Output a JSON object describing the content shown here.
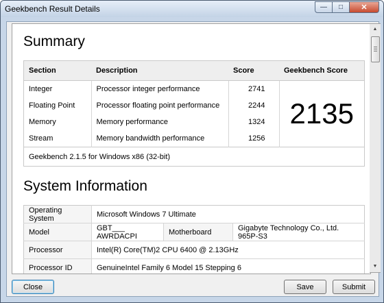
{
  "window": {
    "title": "Geekbench Result Details"
  },
  "window_buttons": {
    "minimize": "—",
    "maximize": "□",
    "close": "✕"
  },
  "summary": {
    "heading": "Summary",
    "columns": [
      "Section",
      "Description",
      "Score",
      "Geekbench Score"
    ],
    "rows": [
      {
        "section": "Integer",
        "description": "Processor integer performance",
        "score": "2741"
      },
      {
        "section": "Floating Point",
        "description": "Processor floating point performance",
        "score": "2244"
      },
      {
        "section": "Memory",
        "description": "Memory performance",
        "score": "1324"
      },
      {
        "section": "Stream",
        "description": "Memory bandwidth performance",
        "score": "1256"
      }
    ],
    "geekbench_score": "2135",
    "version_note": "Geekbench 2.1.5 for Windows x86 (32-bit)"
  },
  "system_information": {
    "heading": "System Information",
    "operating_system": {
      "label": "Operating System",
      "value": "Microsoft Windows 7 Ultimate"
    },
    "model": {
      "label": "Model",
      "value": "GBT___ AWRDACPI",
      "motherboard_label": "Motherboard",
      "motherboard_value": "Gigabyte Technology Co., Ltd. 965P-S3"
    },
    "processor": {
      "label": "Processor",
      "value": "Intel(R) Core(TM)2 CPU 6400 @ 2.13GHz"
    },
    "processor_id": {
      "label": "Processor ID",
      "value": "GenuineIntel Family 6 Model 15 Stepping 6"
    }
  },
  "buttons": {
    "close": "Close",
    "save": "Save",
    "submit": "Submit"
  }
}
